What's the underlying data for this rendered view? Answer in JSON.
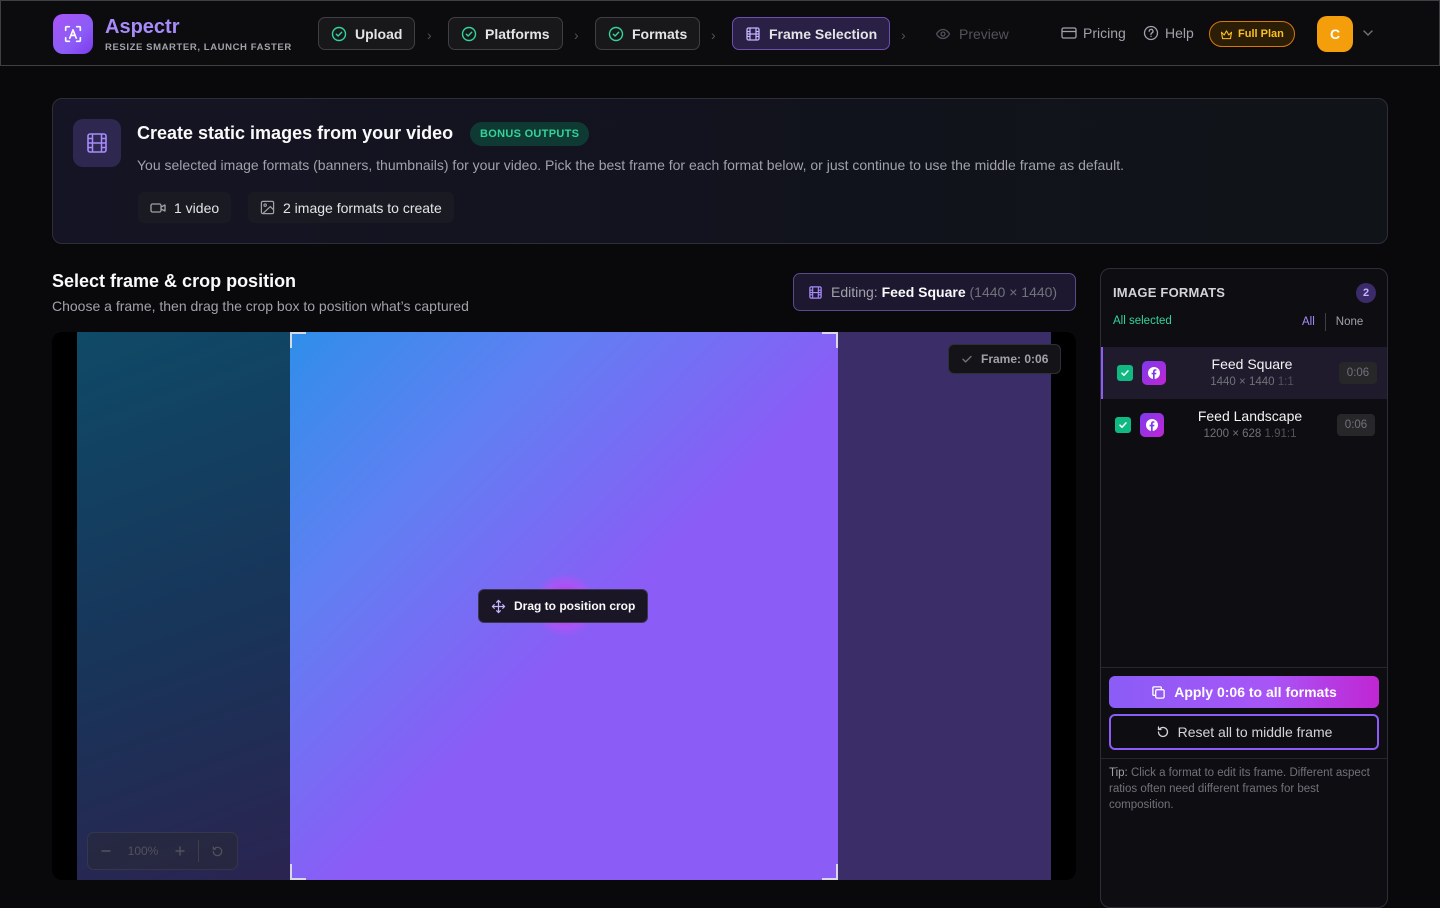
{
  "app": {
    "name": "Aspectr",
    "tagline": "RESIZE SMARTER, LAUNCH FASTER",
    "brand_color": "#8b5cf6"
  },
  "steps": [
    {
      "label": "Upload",
      "state": "done",
      "icon": "check-circle-icon"
    },
    {
      "label": "Platforms",
      "state": "done",
      "icon": "check-circle-icon"
    },
    {
      "label": "Formats",
      "state": "done",
      "icon": "check-circle-icon"
    },
    {
      "label": "Frame Selection",
      "state": "active",
      "icon": "film-icon"
    },
    {
      "label": "Preview",
      "state": "disabled",
      "icon": "eye-icon"
    }
  ],
  "nav": {
    "pricing": "Pricing",
    "help": "Help",
    "plan": "Full Plan",
    "avatar_initial": "C"
  },
  "banner": {
    "title": "Create static images from your video",
    "badge": "BONUS OUTPUTS",
    "description": "You selected image formats (banners, thumbnails) for your video. Pick the best frame for each format below, or just continue to use the middle frame as default.",
    "chip_video": "1 video",
    "chip_formats": "2 image formats to create"
  },
  "editor": {
    "title": "Select frame & crop position",
    "subtitle": "Choose a frame, then drag the crop box to position what’s captured",
    "editing_label": "Editing:",
    "editing_format": "Feed Square",
    "editing_dims": "(1440 × 1440)",
    "drag_tip": "Drag to position crop",
    "frame_badge": "Frame: 0:06",
    "zoom_level": "100%"
  },
  "panel": {
    "title": "IMAGE FORMATS",
    "count": "2",
    "all_selected": "All selected",
    "all": "All",
    "none": "None",
    "formats": [
      {
        "name": "Feed Square",
        "dims": "1440 × 1440",
        "ratio": "1:1",
        "time": "0:06",
        "checked": true,
        "active": true,
        "platform_icon": "facebook-icon"
      },
      {
        "name": "Feed Landscape",
        "dims": "1200 × 628",
        "ratio": "1.91:1",
        "time": "0:06",
        "checked": true,
        "active": false,
        "platform_icon": "facebook-icon"
      }
    ],
    "apply_button": "Apply 0:06 to all formats",
    "reset_button": "Reset all to middle frame",
    "tip_label": "Tip:",
    "tip_text": "Click a format to edit its frame. Different aspect ratios often need different frames for best composition."
  }
}
